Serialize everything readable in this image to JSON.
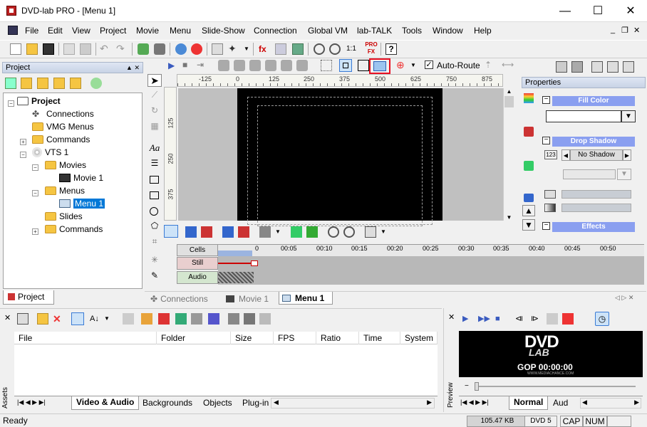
{
  "window": {
    "title": "DVD-lab PRO  - [Menu 1]",
    "minimize": "—",
    "maximize": "☐",
    "close": "✕"
  },
  "menu": [
    "File",
    "Edit",
    "View",
    "Project",
    "Movie",
    "Menu",
    "Slide-Show",
    "Connection",
    "Global VM",
    "lab-TALK",
    "Tools",
    "Window",
    "Help"
  ],
  "mdi": {
    "min": "_",
    "restore": "❐",
    "close": "✕"
  },
  "toolbar2": {
    "auto_route_label": "Auto-Route",
    "zoom_ratio": "1:1",
    "pro_fx": "PRO FX"
  },
  "project_panel": {
    "header": "Project",
    "pin": "▲ ✕",
    "tab": "Project"
  },
  "tree": {
    "root": "Project",
    "connections": "Connections",
    "vmg_menus": "VMG Menus",
    "commands1": "Commands",
    "vts": "VTS 1",
    "movies": "Movies",
    "movie1": "Movie 1",
    "menus": "Menus",
    "menu1": "Menu 1",
    "slides": "Slides",
    "commands2": "Commands"
  },
  "ruler_h": [
    "-125",
    "0",
    "125",
    "250",
    "375",
    "500",
    "625",
    "750",
    "875"
  ],
  "ruler_v": [
    "125",
    "250",
    "375"
  ],
  "properties": {
    "header": "Properties",
    "fill_color": "Fill Color",
    "drop_shadow": "Drop Shadow",
    "no_shadow": "No Shadow",
    "effects": "Effects",
    "num_badge": "123"
  },
  "timeline": {
    "cells": "Cells",
    "still": "Still",
    "audio": "Audio",
    "ticks": [
      "0",
      "00:05",
      "00:10",
      "00:15",
      "00:20",
      "00:25",
      "00:30",
      "00:35",
      "00:40",
      "00:45",
      "00:50"
    ]
  },
  "doc_tabs": {
    "connections": "Connections",
    "movie1": "Movie 1",
    "menu1": "Menu 1"
  },
  "assets": {
    "side_label": "Assets",
    "columns": [
      "File",
      "Folder",
      "Size",
      "FPS",
      "Ratio",
      "Time",
      "System"
    ],
    "tabs": [
      "Video & Audio",
      "Backgrounds",
      "Objects",
      "Plug-in"
    ]
  },
  "preview": {
    "side_label": "Preview",
    "gop": "GOP 00:00:00",
    "site": "WWW.MEDIACHANCE.COM",
    "logo_top": "DVD",
    "logo_bottom": "LAB",
    "tab_normal": "Normal",
    "tab_aud": "Aud"
  },
  "status": {
    "ready": "Ready",
    "size": "105.47 KB",
    "disc": "DVD 5",
    "cap": "CAP",
    "num": "NUM"
  },
  "colors": {
    "accent_sel": "#0078d7",
    "highlight": "#e81123",
    "section": "#8a9ff0"
  }
}
